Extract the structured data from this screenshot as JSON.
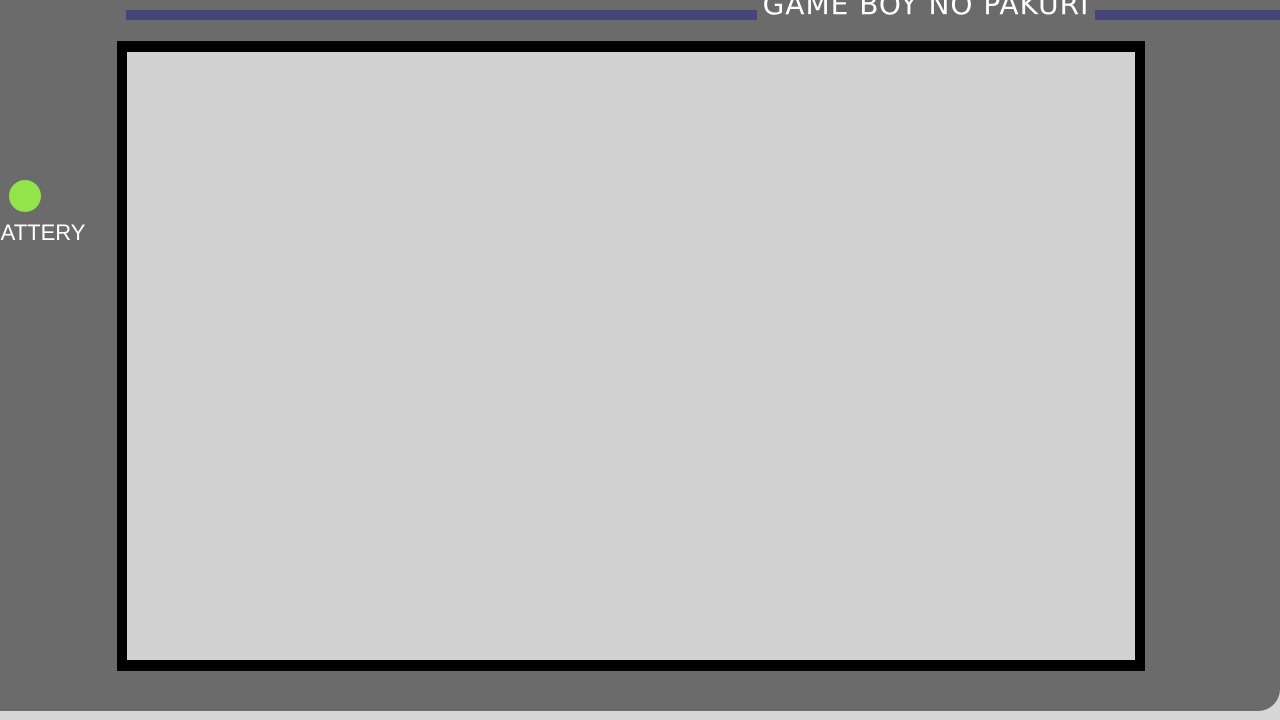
{
  "console": {
    "brand_title": "GAME BOY NO PAKURI",
    "battery_label": "BATTERY",
    "colors": {
      "body": "#6a6b6a",
      "stripe": "#45457a",
      "bezel": "#000000",
      "screen": "#d2d2d2",
      "battery_led": "#93e44b",
      "background": "#d6d6d6"
    }
  }
}
